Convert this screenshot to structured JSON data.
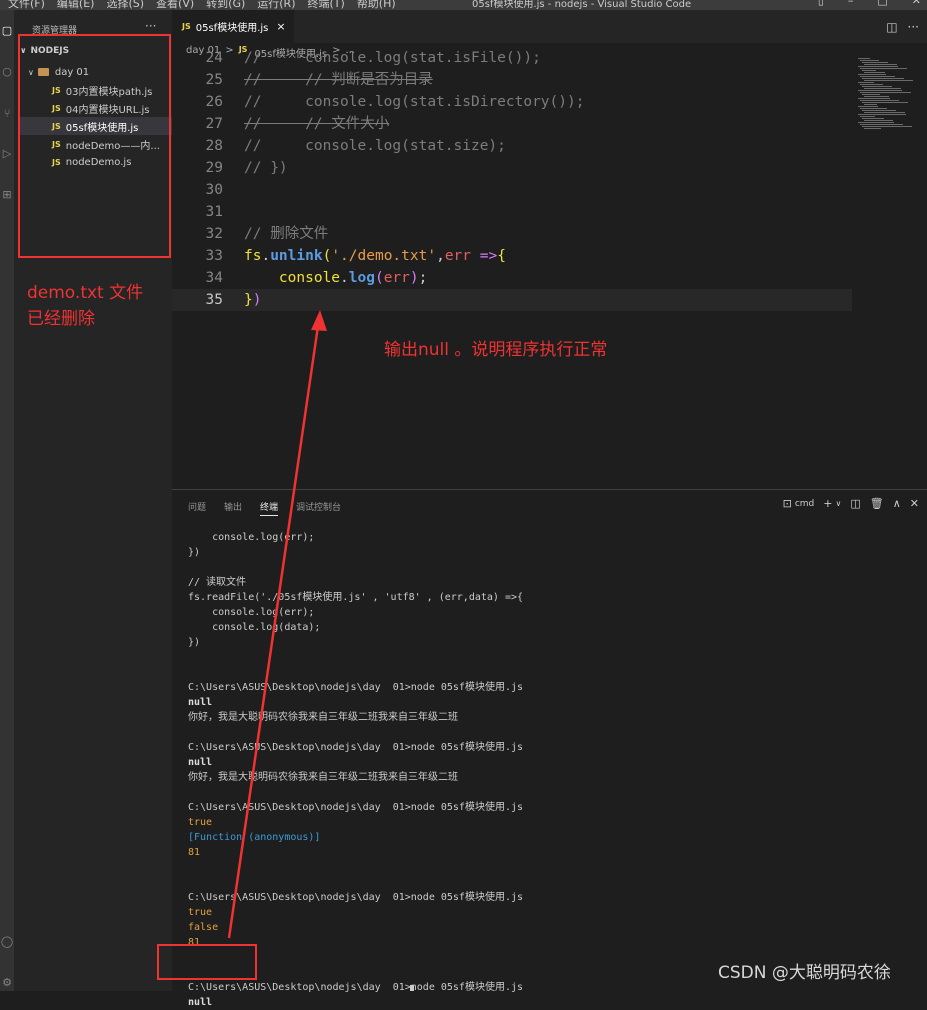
{
  "titlebar": {
    "menu": [
      "文件(F)",
      "编辑(E)",
      "选择(S)",
      "查看(V)",
      "转到(G)",
      "运行(R)",
      "终端(T)",
      "帮助(H)"
    ],
    "window_title": "05sf模块使用.js - nodejs - Visual Studio Code"
  },
  "sidebar": {
    "title": "资源管理器",
    "more": "···",
    "root": "NODEJS",
    "folder": "day  01",
    "files": [
      "03内置模块path.js",
      "04内置模块URL.js",
      "05sf模块使用.js",
      "nodeDemo——内...",
      "nodeDemo.js"
    ],
    "selected_file_index": 2
  },
  "editor": {
    "tab": "05sf模块使用.js",
    "tab_close": "×",
    "breadcrumb": [
      "day  01",
      ">",
      "JS",
      "05sf模块使用.js",
      ">",
      "..."
    ],
    "lines": [
      {
        "n": "24",
        "text": "//     console.log(stat.isFile());"
      },
      {
        "n": "25",
        "text": "//     // 判断是否为目录"
      },
      {
        "n": "26",
        "text": "//     console.log(stat.isDirectory());"
      },
      {
        "n": "27",
        "text": "//     // 文件大小"
      },
      {
        "n": "28",
        "text": "//     console.log(stat.size);"
      },
      {
        "n": "29",
        "text": "// })"
      },
      {
        "n": "30",
        "text": ""
      },
      {
        "n": "31",
        "text": ""
      },
      {
        "n": "32",
        "text": "// 删除文件"
      },
      {
        "n": "33",
        "text": "fs.unlink('./demo.txt',err =>{"
      },
      {
        "n": "34",
        "text": "    console.log(err);"
      },
      {
        "n": "35",
        "text": "})"
      }
    ]
  },
  "panel": {
    "tabs": [
      "问题",
      "输出",
      "终端",
      "调试控制台"
    ],
    "active_tab": "终端",
    "shell": "cmd",
    "terminal_lines": [
      "    console.log(err);",
      "})",
      "",
      "// 读取文件",
      "fs.readFile('./05sf模块使用.js' , 'utf8' , (err,data) =>{",
      "    console.log(err);",
      "    console.log(data);",
      "})",
      "",
      "",
      "C:\\Users\\ASUS\\Desktop\\nodejs\\day  01>node 05sf模块使用.js",
      "null",
      "你好，我是大聪明码农徐我来自三年级二班我来自三年级二班",
      "",
      "C:\\Users\\ASUS\\Desktop\\nodejs\\day  01>node 05sf模块使用.js",
      "null",
      "你好，我是大聪明码农徐我来自三年级二班我来自三年级二班",
      "",
      "C:\\Users\\ASUS\\Desktop\\nodejs\\day  01>node 05sf模块使用.js",
      "true",
      "[Function (anonymous)]",
      "81",
      "",
      "",
      "C:\\Users\\ASUS\\Desktop\\nodejs\\day  01>node 05sf模块使用.js",
      "true",
      "false",
      "81",
      "",
      "",
      "C:\\Users\\ASUS\\Desktop\\nodejs\\day  01>node 05sf模块使用.js",
      "null"
    ]
  },
  "annotations": {
    "deleted_note_line1": "demo.txt  文件",
    "deleted_note_line2": "已经删除",
    "output_note": "输出null 。说明程序执行正常",
    "color": "#ef3232"
  },
  "watermark": "CSDN @大聪明码农徐"
}
